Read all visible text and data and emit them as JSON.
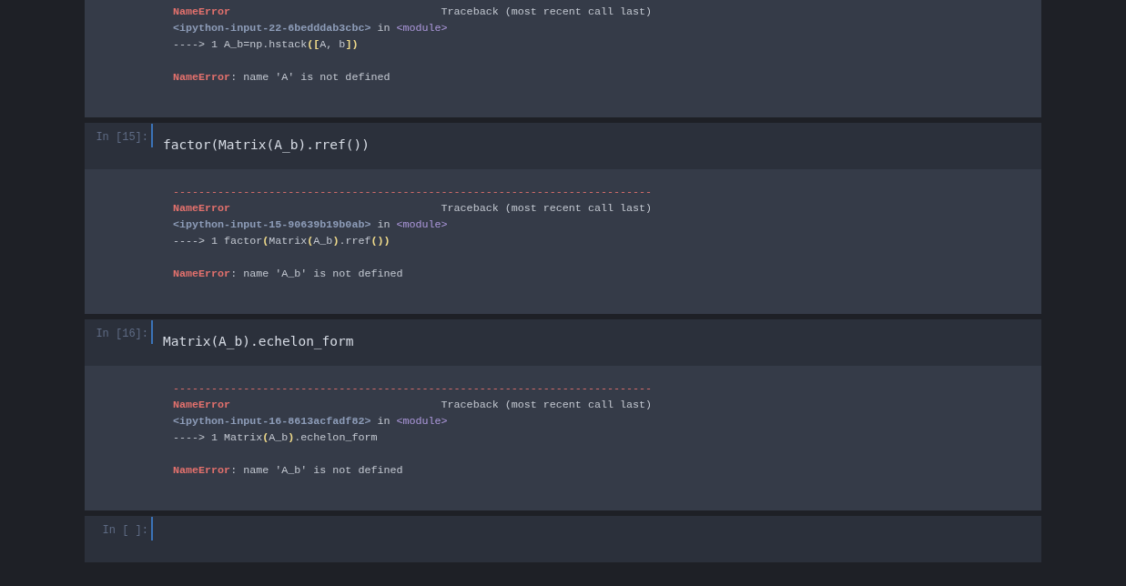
{
  "cells": [
    {
      "output": {
        "lines": [
          {
            "kind": "header",
            "segments": [
              {
                "kind": "error",
                "text": "NameError"
              },
              {
                "kind": "text",
                "text": "Traceback (most recent call last)"
              }
            ]
          },
          {
            "kind": "line",
            "segments": [
              {
                "kind": "path",
                "text": "<ipython-input-22-6bedddab3cbc>"
              },
              {
                "kind": "text",
                "text": " in "
              },
              {
                "kind": "module",
                "text": "<module>"
              }
            ]
          },
          {
            "kind": "line",
            "segments": [
              {
                "kind": "text",
                "text": "----> 1 A_b=np.hstack"
              },
              {
                "kind": "paren",
                "text": "(["
              },
              {
                "kind": "text",
                "text": "A, b"
              },
              {
                "kind": "paren",
                "text": "])"
              }
            ]
          },
          {
            "kind": "blank"
          },
          {
            "kind": "line",
            "segments": [
              {
                "kind": "error",
                "text": "NameError"
              },
              {
                "kind": "text",
                "text": ": name 'A' is not defined"
              }
            ]
          }
        ]
      }
    },
    {
      "prompt": "In [15]:",
      "code": "factor(Matrix(A_b).rref())",
      "output": {
        "lines": [
          {
            "kind": "rule",
            "segments": [
              {
                "kind": "rule",
                "text": "---------------------------------------------------------------------------"
              }
            ]
          },
          {
            "kind": "header",
            "segments": [
              {
                "kind": "error",
                "text": "NameError"
              },
              {
                "kind": "text",
                "text": "Traceback (most recent call last)"
              }
            ]
          },
          {
            "kind": "line",
            "segments": [
              {
                "kind": "path",
                "text": "<ipython-input-15-90639b19b0ab>"
              },
              {
                "kind": "text",
                "text": " in "
              },
              {
                "kind": "module",
                "text": "<module>"
              }
            ]
          },
          {
            "kind": "line",
            "segments": [
              {
                "kind": "text",
                "text": "----> 1 factor"
              },
              {
                "kind": "paren",
                "text": "("
              },
              {
                "kind": "text",
                "text": "Matrix"
              },
              {
                "kind": "paren",
                "text": "("
              },
              {
                "kind": "text",
                "text": "A_b"
              },
              {
                "kind": "paren",
                "text": ")"
              },
              {
                "kind": "text",
                "text": ".rref"
              },
              {
                "kind": "paren",
                "text": "())"
              }
            ]
          },
          {
            "kind": "blank"
          },
          {
            "kind": "line",
            "segments": [
              {
                "kind": "error",
                "text": "NameError"
              },
              {
                "kind": "text",
                "text": ": name 'A_b' is not defined"
              }
            ]
          }
        ]
      }
    },
    {
      "prompt": "In [16]:",
      "code": "Matrix(A_b).echelon_form",
      "output": {
        "lines": [
          {
            "kind": "rule",
            "segments": [
              {
                "kind": "rule",
                "text": "---------------------------------------------------------------------------"
              }
            ]
          },
          {
            "kind": "header",
            "segments": [
              {
                "kind": "error",
                "text": "NameError"
              },
              {
                "kind": "text",
                "text": "Traceback (most recent call last)"
              }
            ]
          },
          {
            "kind": "line",
            "segments": [
              {
                "kind": "path",
                "text": "<ipython-input-16-8613acfadf82>"
              },
              {
                "kind": "text",
                "text": " in "
              },
              {
                "kind": "module",
                "text": "<module>"
              }
            ]
          },
          {
            "kind": "line",
            "segments": [
              {
                "kind": "text",
                "text": "----> 1 Matrix"
              },
              {
                "kind": "paren",
                "text": "("
              },
              {
                "kind": "text",
                "text": "A_b"
              },
              {
                "kind": "paren",
                "text": ")"
              },
              {
                "kind": "text",
                "text": ".echelon_form"
              }
            ]
          },
          {
            "kind": "blank"
          },
          {
            "kind": "line",
            "segments": [
              {
                "kind": "error",
                "text": "NameError"
              },
              {
                "kind": "text",
                "text": ": name 'A_b' is not defined"
              }
            ]
          }
        ]
      }
    },
    {
      "prompt": "In [ ]:"
    }
  ]
}
